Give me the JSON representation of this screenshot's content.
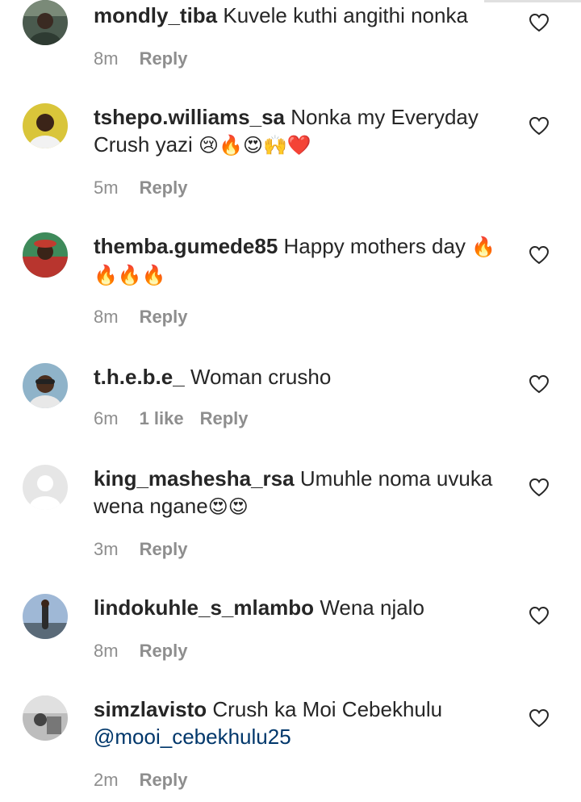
{
  "comments": [
    {
      "username": "mondly_tiba",
      "text_segments": [
        {
          "type": "text",
          "value": "Kuvele kuthi angithi nonka"
        }
      ],
      "time": "8m",
      "likes": "",
      "reply": "Reply"
    },
    {
      "username": "tshepo.williams_sa",
      "text_segments": [
        {
          "type": "text",
          "value": "Nonka my Everyday Crush yazi "
        },
        {
          "type": "emoji",
          "value": "😢🔥😍🙌❤️"
        }
      ],
      "time": "5m",
      "likes": "",
      "reply": "Reply"
    },
    {
      "username": "themba.gumede85",
      "text_segments": [
        {
          "type": "text",
          "value": "Happy mothers day "
        },
        {
          "type": "emoji",
          "value": "🔥 🔥🔥🔥"
        }
      ],
      "time": "8m",
      "likes": "",
      "reply": "Reply"
    },
    {
      "username": "t.h.e.b.e_",
      "text_segments": [
        {
          "type": "text",
          "value": "Woman crusho"
        }
      ],
      "time": "6m",
      "likes": "1 like",
      "reply": "Reply"
    },
    {
      "username": "king_mashesha_rsa",
      "text_segments": [
        {
          "type": "text",
          "value": "Umuhle noma uvuka wena ngane"
        },
        {
          "type": "emoji",
          "value": "😍😍"
        }
      ],
      "time": "3m",
      "likes": "",
      "reply": "Reply"
    },
    {
      "username": "lindokuhle_s_mlambo",
      "text_segments": [
        {
          "type": "text",
          "value": "Wena njalo"
        }
      ],
      "time": "8m",
      "likes": "",
      "reply": "Reply"
    },
    {
      "username": "simzlavisto",
      "text_segments": [
        {
          "type": "text",
          "value": "Crush ka Moi Cebekhulu "
        },
        {
          "type": "mention",
          "value": "@mooi_cebekhulu25"
        }
      ],
      "time": "2m",
      "likes": "",
      "reply": "Reply"
    }
  ],
  "icons": {
    "like": "heart-outline-icon",
    "default_avatar": "default-avatar-icon"
  },
  "colors": {
    "text": "#262626",
    "meta": "#8e8e8e",
    "mention": "#00376b",
    "background": "#ffffff"
  }
}
